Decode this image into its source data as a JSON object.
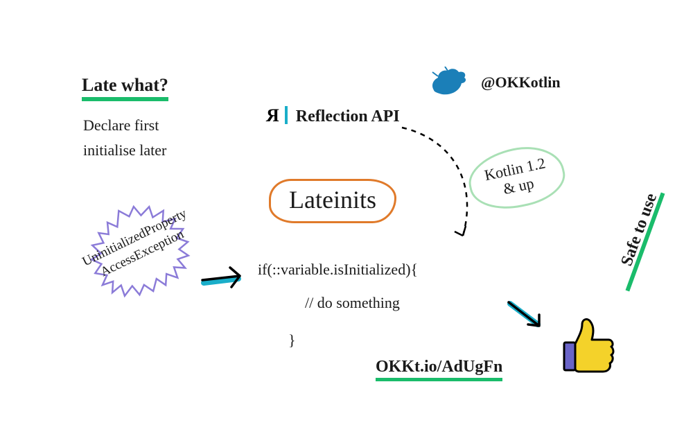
{
  "header": {
    "title": "Late what?",
    "subtitle_line1": "Declare first",
    "subtitle_line2": "initialise later"
  },
  "handle": "@OKKotlin",
  "center": {
    "main": "Lateinits",
    "reflection_label": "Reflection API",
    "version_line1": "Kotlin 1.2",
    "version_line2": "& up"
  },
  "code": {
    "line1": "if(::variable.isInitialized){",
    "line2": "// do something",
    "line3": "}"
  },
  "exception": {
    "line1": "UninitializedProperty",
    "line2": "AccessException"
  },
  "safe_label": "Safe to use",
  "link": "OKKt.io/AdUgFn",
  "colors": {
    "green": "#1abc6b",
    "orange": "#e07a2a",
    "cyan": "#1aaec9",
    "purple": "#8b7bd8",
    "lightgreen": "#a9e0b5",
    "blue": "#1b7fb8",
    "yellow": "#f4d22a"
  }
}
